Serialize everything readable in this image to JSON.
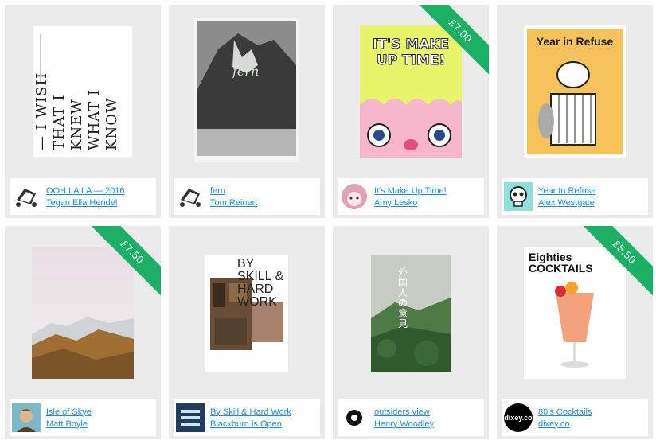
{
  "cards": [
    {
      "title": "OOH LA LA — 2016",
      "author": "Tegan Ella Hendel",
      "cover_text": "— I WISH THAT I KNEW WHAT I KNOW"
    },
    {
      "title": "fern",
      "author": "Tom Reinert",
      "cover_text": "fern"
    },
    {
      "title": "It's Make Up Time!",
      "author": "Amy Lesko",
      "price": "£7.00",
      "cover_text": "IT'S MAKE UP TIME!"
    },
    {
      "title": "Year In Refuse",
      "author": "Alex Westgate",
      "cover_text": "Year in Refuse"
    },
    {
      "title": "Isle of Skye",
      "author": "Matt Boyle",
      "price": "£7.50"
    },
    {
      "title": "By Skill & Hard Work",
      "author": "Blackburn is Open",
      "cover_text": "BY SKILL & HARD WORK"
    },
    {
      "title": "outsiders view",
      "author": "Henry Woodley",
      "cover_text": "外国人の意見"
    },
    {
      "title": "80's Cocktails",
      "author": "dixey.co",
      "price": "£5.50",
      "cover_text": "Eighties COCKTAILS",
      "avatar_text": "dixey.co"
    }
  ],
  "colors": {
    "link": "#1a8fd6",
    "ribbon": "#1bb064",
    "card_bg": "#ebebeb"
  }
}
